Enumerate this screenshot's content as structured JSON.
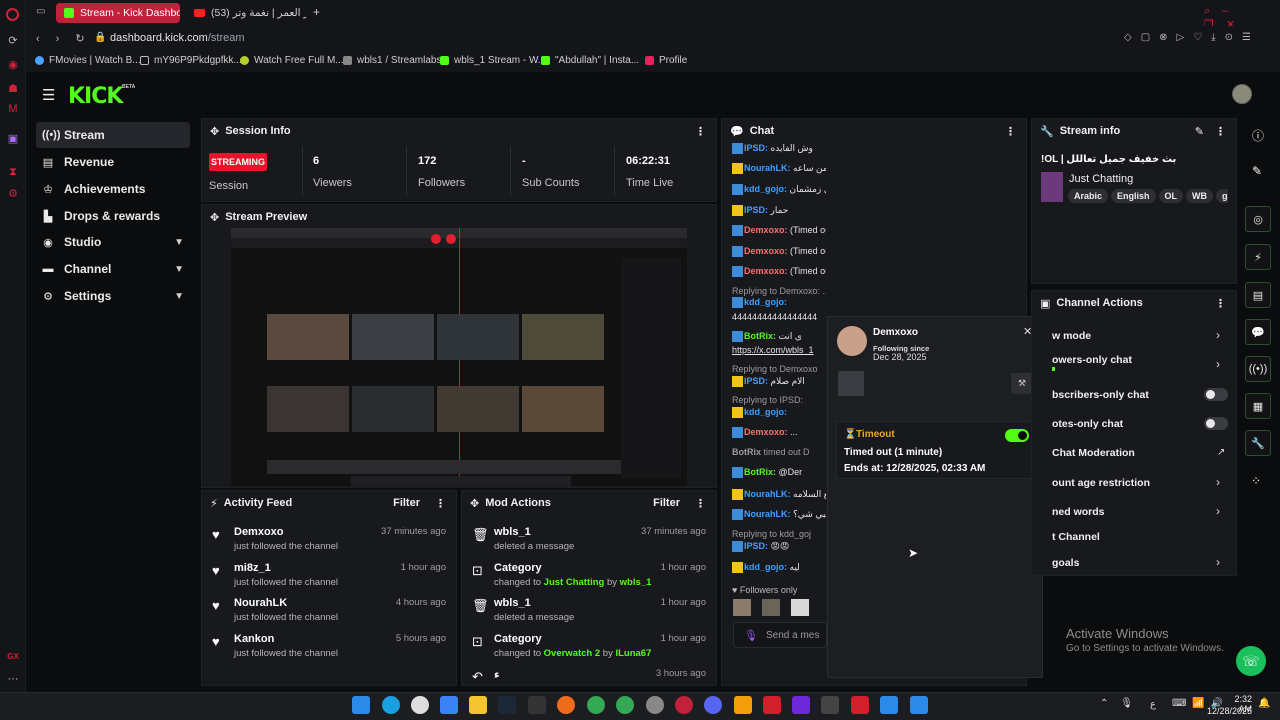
{
  "browser": {
    "tabs": [
      {
        "title": "Stream - Kick Dashboard",
        "active": true
      },
      {
        "title": "(53) عمر العمر | نغمة وتر - ...",
        "active": false
      }
    ],
    "url_host": "dashboard.kick.com",
    "url_path": "/stream",
    "bookmarks": [
      "FMovies | Watch B...",
      "mY96P9Pkdgpfkk...",
      "Watch Free Full M...",
      "wbls1 / Streamlabs",
      "wbls_1 Stream - W...",
      "\"Abdullah\" | Insta...",
      "Profile"
    ]
  },
  "sidebar": {
    "logo": "KICK",
    "beta": "BETA",
    "items": [
      {
        "label": "Stream",
        "icon": "stream-icon"
      },
      {
        "label": "Revenue",
        "icon": "revenue-icon"
      },
      {
        "label": "Achievements",
        "icon": "trophy-icon"
      },
      {
        "label": "Drops & rewards",
        "icon": "drops-icon"
      },
      {
        "label": "Studio",
        "icon": "studio-icon"
      },
      {
        "label": "Channel",
        "icon": "channel-icon"
      },
      {
        "label": "Settings",
        "icon": "gear-icon"
      }
    ]
  },
  "session_info": {
    "title": "Session Info",
    "status_badge": "STREAMING",
    "status_label": "Session",
    "stats": [
      {
        "value": "6",
        "label": "Viewers"
      },
      {
        "value": "172",
        "label": "Followers"
      },
      {
        "value": "-",
        "label": "Sub Counts"
      },
      {
        "value": "06:22:31",
        "label": "Time Live"
      }
    ]
  },
  "stream_preview": {
    "title": "Stream Preview"
  },
  "activity_feed": {
    "title": "Activity Feed",
    "filter": "Filter",
    "items": [
      {
        "name": "Demxoxo",
        "sub": "just followed the channel",
        "time": "37 minutes ago"
      },
      {
        "name": "mi8z_1",
        "sub": "just followed the channel",
        "time": "1 hour ago"
      },
      {
        "name": "NourahLK",
        "sub": "just followed the channel",
        "time": "4 hours ago"
      },
      {
        "name": "Kankon",
        "sub": "just followed the channel",
        "time": "5 hours ago"
      }
    ]
  },
  "mod_actions": {
    "title": "Mod Actions",
    "filter": "Filter",
    "items": [
      {
        "name": "wbls_1",
        "sub": "deleted a message",
        "time": "37 minutes ago"
      },
      {
        "name": "Category",
        "sub_pre": "changed to ",
        "sub_cat": "Just Chatting",
        "sub_by": " by ",
        "sub_user": "wbls_1",
        "time": "1 hour ago"
      },
      {
        "name": "wbls_1",
        "sub": "deleted a message",
        "time": "1 hour ago"
      },
      {
        "name": "Category",
        "sub_pre": "changed to ",
        "sub_cat": "Overwatch 2",
        "sub_by": " by ",
        "sub_user": "ILuna67",
        "time": "1 hour ago"
      },
      {
        "name": "ء",
        "sub": "",
        "time": "3 hours ago"
      }
    ]
  },
  "chat": {
    "title": "Chat",
    "lines": [
      {
        "user": "IPSD:",
        "text": "وش الفايده",
        "color": "blue"
      },
      {
        "user": "NourahLK:",
        "text": "انا انكر تركي يندام من ساعه",
        "color": "blue"
      },
      {
        "user": "kdd_gojo:",
        "text": "انا بخزل قل زمشمان",
        "color": "blue"
      },
      {
        "user": "IPSD:",
        "text": "حمار",
        "color": "blue"
      },
      {
        "user": "Demxoxo:",
        "text": "(Timed out)",
        "color": "red"
      },
      {
        "user": "Demxoxo:",
        "text": "(Timed out)",
        "color": "red"
      },
      {
        "user": "Demxoxo:",
        "text": "(Timed out)",
        "color": "red"
      },
      {
        "user": "",
        "text": "Replying to Demxoxo: ...",
        "color": "gray"
      },
      {
        "user": "kdd_gojo:",
        "text": "",
        "color": "blue"
      },
      {
        "user": "",
        "text": "‏44444444444444444",
        "color": "white"
      },
      {
        "user": "BotRix:",
        "text": "ی انت",
        "color": "green"
      },
      {
        "user": "",
        "text": "https://x.com/wbls_1",
        "color": "link"
      },
      {
        "user": "",
        "text": "Replying to Demxoxo",
        "color": "gray"
      },
      {
        "user": "IPSD:",
        "text": "الام صلام",
        "color": "blue"
      },
      {
        "user": "",
        "text": "Replying to IPSD:",
        "color": "gray"
      },
      {
        "user": "kdd_gojo:",
        "text": "",
        "color": "blue"
      },
      {
        "user": "Demxoxo:",
        "text": "...",
        "color": "red"
      },
      {
        "user": "BotRix",
        "text": " timed out D",
        "color": "gray"
      },
      {
        "user": "BotRix:",
        "text": "@Der",
        "color": "green"
      },
      {
        "user": "NourahLK:",
        "text": "ی مع السلامه",
        "color": "blue"
      },
      {
        "user": "NourahLK:",
        "text": "بتبي شي؟",
        "color": "blue"
      },
      {
        "user": "",
        "text": "Replying to kdd_goj",
        "color": "gray"
      },
      {
        "user": "IPSD:",
        "text": "😡😡",
        "color": "blue"
      },
      {
        "user": "kdd_gojo:",
        "text": "ليه",
        "color": "blue"
      }
    ],
    "followers_only": "Followers only",
    "send_placeholder": "Send a mes"
  },
  "user_card": {
    "name": "Demxoxo",
    "following_label": "Following since",
    "following_date": "Dec 28, 2025",
    "timeout_title": "Timeout",
    "timeout_text": "Timed out (1 minute)",
    "timeout_ends": "Ends at: 12/28/2025, 02:33 AM"
  },
  "stream_info": {
    "title": "Stream info",
    "stream_title": "!OL | بث خفيف جميل تعاللل",
    "category": "Just Chatting",
    "tags": [
      "Arabic",
      "English",
      "OL",
      "WB",
      "ga"
    ]
  },
  "channel_actions": {
    "title": "Channel Actions",
    "rows": [
      {
        "label": "w mode",
        "kind": "chev"
      },
      {
        "label": "owers-only chat",
        "kind": "chev"
      },
      {
        "label": "bscribers-only chat",
        "kind": "toggle"
      },
      {
        "label": "otes-only chat",
        "kind": "toggle"
      },
      {
        "label": "Chat Moderation",
        "kind": "ext"
      },
      {
        "label": "ount age restriction",
        "kind": "chev"
      },
      {
        "label": "ned words",
        "kind": "chev"
      },
      {
        "label": "t Channel",
        "kind": "none"
      },
      {
        "label": "goals",
        "kind": "chev"
      }
    ]
  },
  "watermark": {
    "line1": "Activate Windows",
    "line2": "Go to Settings to activate Windows."
  },
  "taskbar": {
    "time": "2:32 AM",
    "date": "12/28/2025",
    "lang": "ع"
  },
  "colors": {
    "accent": "#53fc18",
    "streaming": "#e4162b",
    "tab_active": "#c2213b"
  }
}
